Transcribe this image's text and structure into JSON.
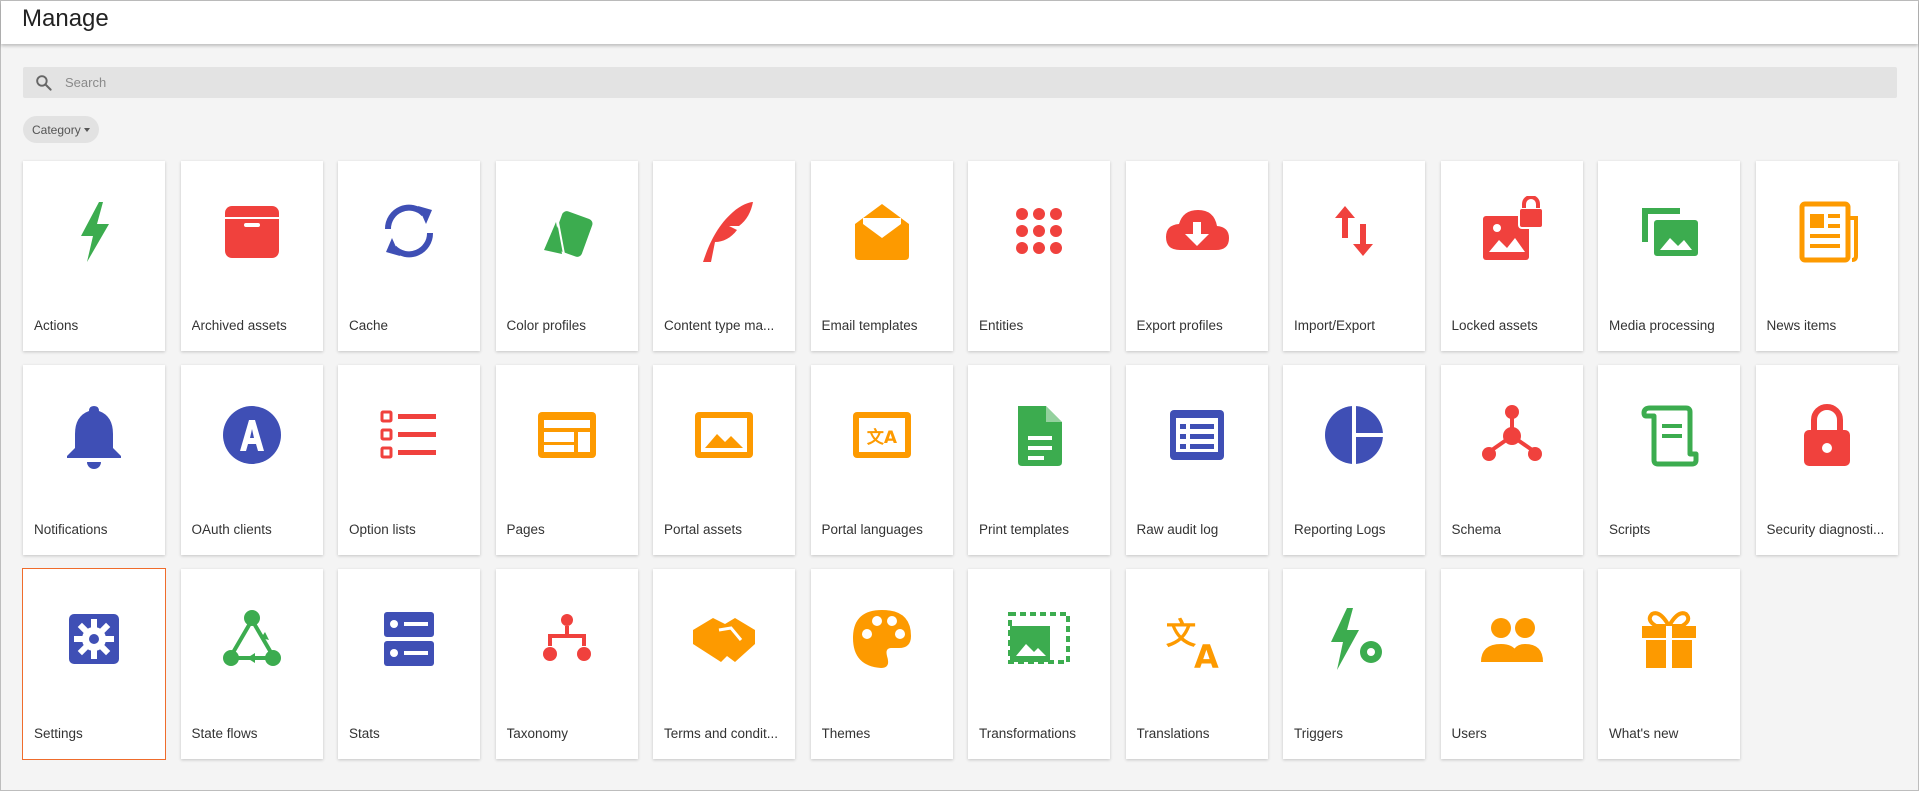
{
  "header": {
    "title": "Manage"
  },
  "search": {
    "placeholder": "Search",
    "value": ""
  },
  "filter": {
    "category_label": "Category"
  },
  "colors": {
    "green": "#3cac4f",
    "red": "#f0413d",
    "blue": "#3f4fb5",
    "orange": "#fd9a00",
    "selected_outline": "#ef6c2c"
  },
  "cards": [
    {
      "label": "Actions",
      "icon": "lightning-icon",
      "color": "#3cac4f"
    },
    {
      "label": "Archived assets",
      "icon": "archive-box-icon",
      "color": "#f0413d"
    },
    {
      "label": "Cache",
      "icon": "refresh-icon",
      "color": "#3f4fb5"
    },
    {
      "label": "Color profiles",
      "icon": "color-swatches-icon",
      "color": "#3cac4f"
    },
    {
      "label": "Content type ma...",
      "icon": "feather-quill-icon",
      "color": "#f0413d"
    },
    {
      "label": "Email templates",
      "icon": "open-envelope-icon",
      "color": "#fd9a00"
    },
    {
      "label": "Entities",
      "icon": "dot-grid-icon",
      "color": "#f0413d"
    },
    {
      "label": "Export profiles",
      "icon": "cloud-download-icon",
      "color": "#f0413d"
    },
    {
      "label": "Import/Export",
      "icon": "up-down-arrows-icon",
      "color": "#f0413d"
    },
    {
      "label": "Locked assets",
      "icon": "locked-image-icon",
      "color": "#f0413d"
    },
    {
      "label": "Media processing",
      "icon": "media-images-icon",
      "color": "#3cac4f"
    },
    {
      "label": "News items",
      "icon": "newspaper-icon",
      "color": "#fd9a00"
    },
    {
      "label": "Notifications",
      "icon": "bell-icon",
      "color": "#3f4fb5"
    },
    {
      "label": "OAuth clients",
      "icon": "oauth-a-icon",
      "color": "#3f4fb5"
    },
    {
      "label": "Option lists",
      "icon": "checklist-icon",
      "color": "#f0413d"
    },
    {
      "label": "Pages",
      "icon": "page-layout-icon",
      "color": "#fd9a00"
    },
    {
      "label": "Portal assets",
      "icon": "image-frame-icon",
      "color": "#fd9a00"
    },
    {
      "label": "Portal languages",
      "icon": "language-frame-icon",
      "color": "#fd9a00"
    },
    {
      "label": "Print templates",
      "icon": "document-icon",
      "color": "#3cac4f"
    },
    {
      "label": "Raw audit log",
      "icon": "list-box-icon",
      "color": "#3f4fb5"
    },
    {
      "label": "Reporting Logs",
      "icon": "pie-chart-icon",
      "color": "#3f4fb5"
    },
    {
      "label": "Schema",
      "icon": "hub-nodes-icon",
      "color": "#f0413d"
    },
    {
      "label": "Scripts",
      "icon": "scroll-icon",
      "color": "#3cac4f"
    },
    {
      "label": "Security diagnosti...",
      "icon": "padlock-icon",
      "color": "#f0413d"
    },
    {
      "label": "Settings",
      "icon": "gear-box-icon",
      "color": "#3f4fb5",
      "selected": true
    },
    {
      "label": "State flows",
      "icon": "state-flow-icon",
      "color": "#3cac4f"
    },
    {
      "label": "Stats",
      "icon": "server-stack-icon",
      "color": "#3f4fb5"
    },
    {
      "label": "Taxonomy",
      "icon": "hierarchy-icon",
      "color": "#f0413d"
    },
    {
      "label": "Terms and condit...",
      "icon": "handshake-icon",
      "color": "#fd9a00"
    },
    {
      "label": "Themes",
      "icon": "palette-icon",
      "color": "#fd9a00"
    },
    {
      "label": "Transformations",
      "icon": "image-crop-icon",
      "color": "#3cac4f"
    },
    {
      "label": "Translations",
      "icon": "translate-icon",
      "color": "#fd9a00"
    },
    {
      "label": "Triggers",
      "icon": "lightning-gear-icon",
      "color": "#3cac4f"
    },
    {
      "label": "Users",
      "icon": "users-icon",
      "color": "#fd9a00"
    },
    {
      "label": "What's new",
      "icon": "gift-icon",
      "color": "#fd9a00"
    }
  ]
}
